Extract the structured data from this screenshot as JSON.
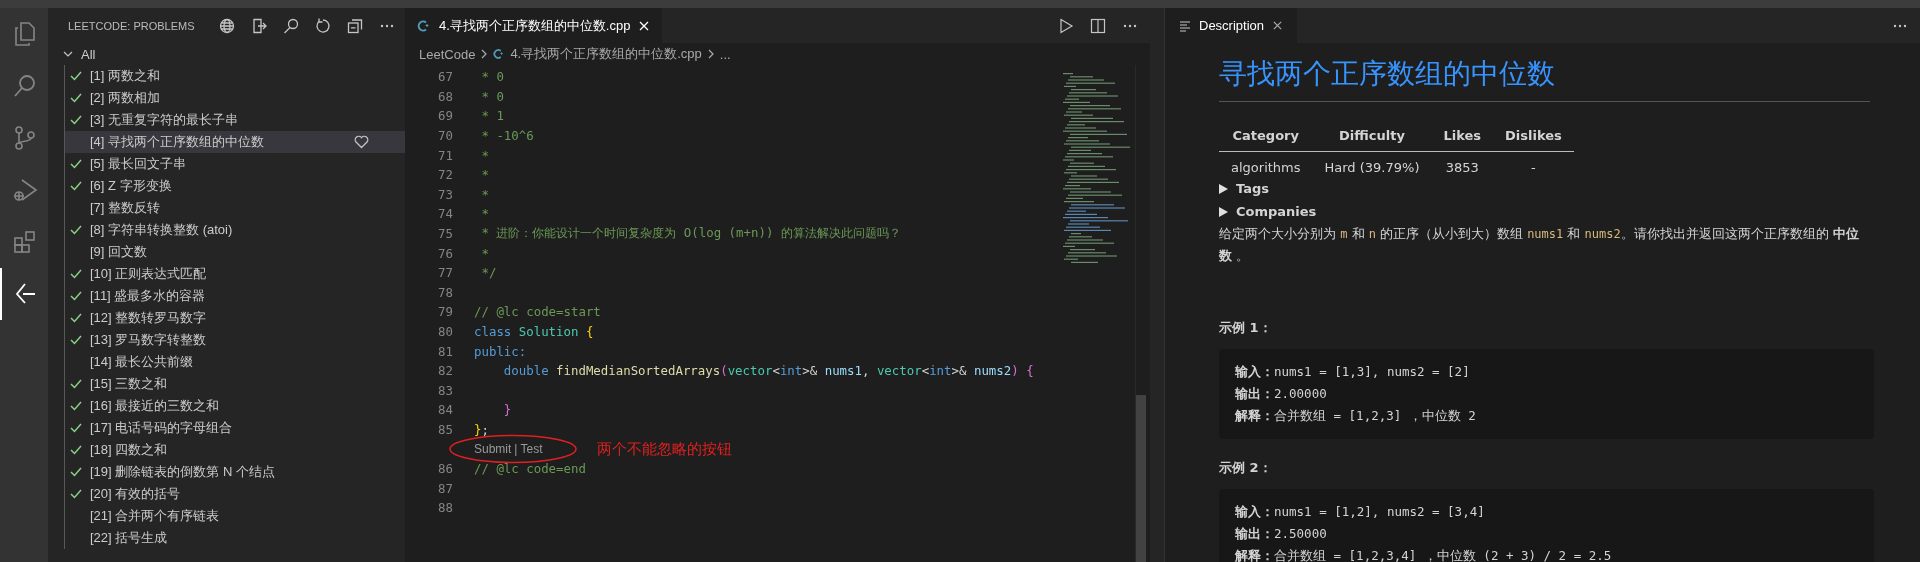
{
  "activity_bar": [
    {
      "kind": "files",
      "selected": false
    },
    {
      "kind": "search",
      "selected": false
    },
    {
      "kind": "source-control",
      "selected": false
    },
    {
      "kind": "debug",
      "selected": false
    },
    {
      "kind": "extensions",
      "selected": false
    },
    {
      "kind": "leetcode",
      "selected": true
    }
  ],
  "sidebar": {
    "title": "LEETCODE: PROBLEMS",
    "root": {
      "label": "All",
      "expanded": true,
      "children": [
        {
          "label": "[1] 两数之和",
          "solved": true,
          "selected": false
        },
        {
          "label": "[2] 两数相加",
          "solved": true,
          "selected": false
        },
        {
          "label": "[3] 无重复字符的最长子串",
          "solved": true,
          "selected": false
        },
        {
          "label": "[4] 寻找两个正序数组的中位数",
          "solved": false,
          "selected": true
        },
        {
          "label": "[5] 最长回文子串",
          "solved": true,
          "selected": false
        },
        {
          "label": "[6] Z 字形变换",
          "solved": true,
          "selected": false
        },
        {
          "label": "[7] 整数反转",
          "solved": false,
          "selected": false
        },
        {
          "label": "[8] 字符串转换整数 (atoi)",
          "solved": true,
          "selected": false
        },
        {
          "label": "[9] 回文数",
          "solved": false,
          "selected": false
        },
        {
          "label": "[10] 正则表达式匹配",
          "solved": true,
          "selected": false
        },
        {
          "label": "[11] 盛最多水的容器",
          "solved": true,
          "selected": false
        },
        {
          "label": "[12] 整数转罗马数字",
          "solved": true,
          "selected": false
        },
        {
          "label": "[13] 罗马数字转整数",
          "solved": true,
          "selected": false
        },
        {
          "label": "[14] 最长公共前缀",
          "solved": false,
          "selected": false
        },
        {
          "label": "[15] 三数之和",
          "solved": true,
          "selected": false
        },
        {
          "label": "[16] 最接近的三数之和",
          "solved": true,
          "selected": false
        },
        {
          "label": "[17] 电话号码的字母组合",
          "solved": true,
          "selected": false
        },
        {
          "label": "[18] 四数之和",
          "solved": true,
          "selected": false
        },
        {
          "label": "[19] 删除链表的倒数第 N 个结点",
          "solved": true,
          "selected": false
        },
        {
          "label": "[20] 有效的括号",
          "solved": true,
          "selected": false
        },
        {
          "label": "[21] 合并两个有序链表",
          "solved": false,
          "selected": false
        },
        {
          "label": "[22] 括号生成",
          "solved": false,
          "selected": false
        }
      ]
    }
  },
  "editor": {
    "tab": {
      "label": "4.寻找两个正序数组的中位数.cpp",
      "selected": true
    },
    "breadcrumb": [
      "LeetCode",
      "4.寻找两个正序数组的中位数.cpp",
      "..."
    ],
    "lines": [
      {
        "kind": "code",
        "number": "67",
        "tokens": [
          {
            "text": " * 0",
            "kind": "comment"
          }
        ]
      },
      {
        "kind": "code",
        "number": "68",
        "tokens": [
          {
            "text": " * 0",
            "kind": "comment"
          }
        ]
      },
      {
        "kind": "code",
        "number": "69",
        "tokens": [
          {
            "text": " * 1",
            "kind": "comment"
          }
        ]
      },
      {
        "kind": "code",
        "number": "70",
        "tokens": [
          {
            "text": " * -10^6",
            "kind": "comment"
          }
        ]
      },
      {
        "kind": "code",
        "number": "71",
        "tokens": [
          {
            "text": " *",
            "kind": "comment"
          }
        ]
      },
      {
        "kind": "code",
        "number": "72",
        "tokens": [
          {
            "text": " *",
            "kind": "comment"
          }
        ]
      },
      {
        "kind": "code",
        "number": "73",
        "tokens": [
          {
            "text": " *",
            "kind": "comment"
          }
        ]
      },
      {
        "kind": "code",
        "number": "74",
        "tokens": [
          {
            "text": " *",
            "kind": "comment"
          }
        ]
      },
      {
        "kind": "code",
        "number": "75",
        "tokens": [
          {
            "text": " * 进阶：你能设计一个时间复杂度为 O(log (m+n)) 的算法解决此问题吗？",
            "kind": "comment"
          }
        ]
      },
      {
        "kind": "code",
        "number": "76",
        "tokens": [
          {
            "text": " *",
            "kind": "comment"
          }
        ]
      },
      {
        "kind": "code",
        "number": "77",
        "tokens": [
          {
            "text": " */",
            "kind": "comment"
          }
        ]
      },
      {
        "kind": "code",
        "number": "78"
      },
      {
        "kind": "code",
        "number": "79",
        "tokens": [
          {
            "text": "// @lc code=start",
            "kind": "comment"
          }
        ]
      },
      {
        "kind": "code",
        "number": "80",
        "tokens": [
          {
            "text": "class ",
            "kind": "keyword"
          },
          {
            "text": "Solution ",
            "kind": "type"
          },
          {
            "text": "{",
            "kind": "bracket1"
          }
        ]
      },
      {
        "kind": "code",
        "number": "81",
        "tokens": [
          {
            "text": "public:",
            "kind": "keyword"
          }
        ]
      },
      {
        "kind": "code",
        "number": "82",
        "tokens": [
          {
            "text": "    double ",
            "kind": "keyword"
          },
          {
            "text": "findMedianSortedArrays",
            "kind": "function"
          },
          {
            "text": "(",
            "kind": "bracket2"
          },
          {
            "text": "vector",
            "kind": "type"
          },
          {
            "text": "<",
            "kind": "plain"
          },
          {
            "text": "int",
            "kind": "keyword"
          },
          {
            "text": ">& ",
            "kind": "plain"
          },
          {
            "text": "nums1",
            "kind": "variable"
          },
          {
            "text": ", ",
            "kind": "plain"
          },
          {
            "text": "vector",
            "kind": "type"
          },
          {
            "text": "<",
            "kind": "plain"
          },
          {
            "text": "int",
            "kind": "keyword"
          },
          {
            "text": ">& ",
            "kind": "plain"
          },
          {
            "text": "nums2",
            "kind": "variable"
          },
          {
            "text": ") {",
            "kind": "bracket2"
          }
        ]
      },
      {
        "kind": "code",
        "number": "83"
      },
      {
        "kind": "code",
        "number": "84",
        "tokens": [
          {
            "text": "    }",
            "kind": "bracket2"
          }
        ]
      },
      {
        "kind": "code",
        "number": "85",
        "tokens": [
          {
            "text": "}",
            "kind": "bracket1"
          },
          {
            "text": ";",
            "kind": "plain"
          }
        ]
      },
      {
        "kind": "codelens",
        "actions": [
          "Submit",
          "Test"
        ],
        "separator": "|"
      },
      {
        "kind": "code",
        "number": "86",
        "tokens": [
          {
            "text": "// @lc code=end",
            "kind": "comment"
          }
        ]
      },
      {
        "kind": "code",
        "number": "87"
      },
      {
        "kind": "code",
        "number": "88"
      }
    ],
    "annotation": {
      "text": "两个不能忽略的按钮"
    }
  },
  "description": {
    "tab": {
      "label": "Description",
      "selected": true
    },
    "title": "寻找两个正序数组的中位数",
    "table": {
      "columns": [
        "Category",
        "Difficulty",
        "Likes",
        "Dislikes"
      ],
      "rows": [
        [
          "algorithms",
          "Hard (39.79%)",
          "3853",
          "-"
        ]
      ]
    },
    "sections": [
      {
        "label": "Tags",
        "expanded": false
      },
      {
        "label": "Companies",
        "expanded": false
      }
    ],
    "statement": [
      {
        "kind": "text",
        "text": "给定两个大小分别为 "
      },
      {
        "kind": "code",
        "text": "m"
      },
      {
        "kind": "text",
        "text": " 和 "
      },
      {
        "kind": "code",
        "text": "n"
      },
      {
        "kind": "text",
        "text": " 的正序（从小到大）数组 "
      },
      {
        "kind": "code",
        "text": "nums1"
      },
      {
        "kind": "text",
        "text": " 和 "
      },
      {
        "kind": "code",
        "text": "nums2"
      },
      {
        "kind": "text",
        "text": "。请你找出并返回这两个正序数组的 "
      },
      {
        "kind": "bold",
        "text": "中位数"
      },
      {
        "kind": "text",
        "text": " 。"
      }
    ],
    "examples": [
      {
        "heading": "示例 1：",
        "lines": [
          {
            "label": "输入：",
            "value": "nums1 = [1,3], nums2 = [2]"
          },
          {
            "label": "输出：",
            "value": "2.00000"
          },
          {
            "label": "解释：",
            "value": "合并数组 = [1,2,3] ，中位数 2"
          }
        ]
      },
      {
        "heading": "示例 2：",
        "lines": [
          {
            "label": "输入：",
            "value": "nums1 = [1,2], nums2 = [3,4]"
          },
          {
            "label": "输出：",
            "value": "2.50000"
          },
          {
            "label": "解释：",
            "value": "合并数组 = [1,2,3,4] ，中位数 (2 + 3) / 2 = 2.5"
          }
        ]
      }
    ]
  }
}
